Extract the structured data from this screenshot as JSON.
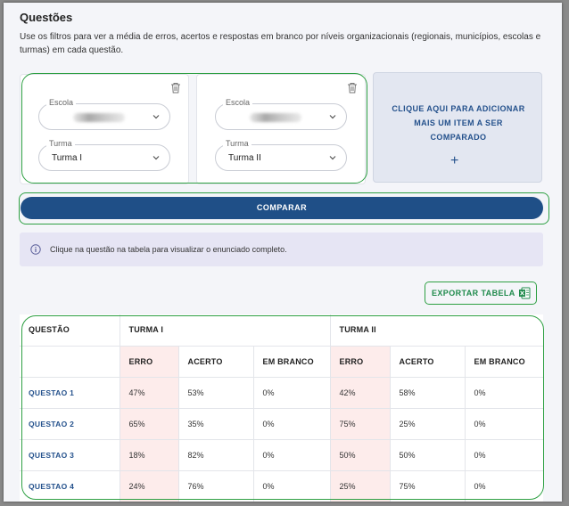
{
  "header": {
    "title": "Questões",
    "description": "Use os filtros para ver a média de erros, acertos e respostas em branco por níveis organizacionais (regionais, municípios, escolas e turmas) em cada questão."
  },
  "filters": [
    {
      "escola_label": "Escola",
      "escola_value": "",
      "turma_label": "Turma",
      "turma_value": "Turma I"
    },
    {
      "escola_label": "Escola",
      "escola_value": "",
      "turma_label": "Turma",
      "turma_value": "Turma II"
    }
  ],
  "add_item": {
    "label": "CLIQUE AQUI PARA ADICIONAR MAIS UM ITEM A SER COMPARADO",
    "plus": "+"
  },
  "compare_button": "COMPARAR",
  "info": {
    "text": "Clique na questão na tabela para visualizar o enunciado completo."
  },
  "export_button": "EXPORTAR TABELA",
  "table": {
    "col_question": "QUESTÃO",
    "groups": [
      "TURMA I",
      "TURMA II"
    ],
    "sub_headers": [
      "ERRO",
      "ACERTO",
      "EM BRANCO"
    ],
    "rows": [
      {
        "q": "QUESTAO 1",
        "v": [
          "47%",
          "53%",
          "0%",
          "42%",
          "58%",
          "0%"
        ]
      },
      {
        "q": "QUESTAO 2",
        "v": [
          "65%",
          "35%",
          "0%",
          "75%",
          "25%",
          "0%"
        ]
      },
      {
        "q": "QUESTAO 3",
        "v": [
          "18%",
          "82%",
          "0%",
          "50%",
          "50%",
          "0%"
        ]
      },
      {
        "q": "QUESTAO 4",
        "v": [
          "24%",
          "76%",
          "0%",
          "25%",
          "75%",
          "0%"
        ]
      }
    ]
  },
  "colors": {
    "accent": "#1f4f87",
    "highlight_outline": "#2ea043",
    "erro_bg": "#fdeceb",
    "excel_green": "#1f8a4c"
  }
}
